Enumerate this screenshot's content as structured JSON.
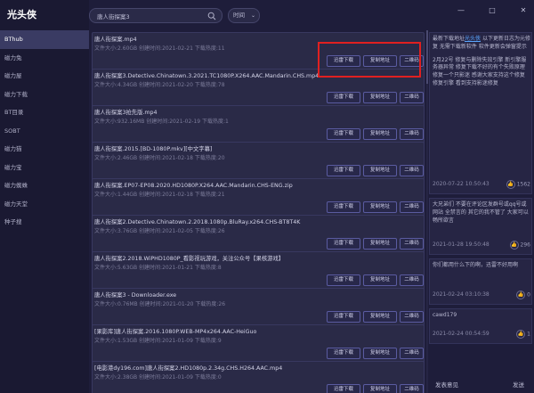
{
  "app": {
    "title": "光头侠"
  },
  "sidebar": {
    "items": [
      {
        "label": "BThub",
        "active": true
      },
      {
        "label": "磁力兔"
      },
      {
        "label": "磁力屋"
      },
      {
        "label": "磁力下载"
      },
      {
        "label": "BT目录"
      },
      {
        "label": "SOBT"
      },
      {
        "label": "磁力猫"
      },
      {
        "label": "磁力宝"
      },
      {
        "label": "磁力蜘蛛"
      },
      {
        "label": "磁力天堂"
      },
      {
        "label": "种子搜"
      }
    ]
  },
  "search": {
    "value": "唐人街探案3",
    "placeholder": ""
  },
  "sort": {
    "label": "时间",
    "icon": "chevron-down-icon"
  },
  "buttons": {
    "thunder": "迅雷下载",
    "copy": "复制地址",
    "qrcode": "二维码"
  },
  "results": [
    {
      "title": "唐人街探案.mp4",
      "meta": "文件大小:2.60GB   创建时间:2021-02-21 下载热度:11"
    },
    {
      "title": "唐人街探案3.Detective.Chinatown.3.2021.TC1080P.X264.AAC.Mandarin.CHS.mp4",
      "meta": "文件大小:4.34GB   创建时间:2021-02-20 下载热度:78"
    },
    {
      "title": "唐人街探案3抢先版.mp4",
      "meta": "文件大小:932.16MB   创建时间:2021-02-19 下载热度:1"
    },
    {
      "title": "唐人街探案.2015.[BD-1080P.mkv][中文字幕]",
      "meta": "文件大小:2.46GB   创建时间:2021-02-18 下载热度:20"
    },
    {
      "title": "唐人街探案.EP07-EP08.2020.HD1080P.X264.AAC.Mandarin.CHS-ENG.zip",
      "meta": "文件大小:1.44GB   创建时间:2021-02-18 下载热度:21"
    },
    {
      "title": "唐人街探案2.Detective.Chinatown.2.2018.1080p.BluRay.x264.CHS-BT8T4K",
      "meta": "文件大小:3.76GB   创建时间:2021-02-05 下载热度:26"
    },
    {
      "title": "唐人街探案2.2018.WiPHD1080P_看影视玩游戏，关注公众号【果核游戏】",
      "meta": "文件大小:5.63GB   创建时间:2021-01-21 下载热度:8"
    },
    {
      "title": "唐人街探案3 - Downloader.exe",
      "meta": "文件大小:0.76MB   创建时间:2021-01-20 下载热度:26"
    },
    {
      "title": "[果影库]唐人街探案.2016.1080P.WEB-MP4x264.AAC-HeiGuo",
      "meta": "文件大小:1.53GB   创建时间:2021-01-09 下载热度:9"
    },
    {
      "title": "[电影港dy196.com]唐人街探案2.HD1080p.2.34g.CHS.H264.AAC.mp4",
      "meta": "文件大小:2.38GB   创建时间:2021-01-09 下载热度:0"
    }
  ],
  "comments": [
    {
      "text_before": "最新下载地址",
      "link": "光头侠",
      "text_after": " 以下更新日志为元修复 无需下载新软件 软件更新会弹窗提示",
      "body": "2月22号 修复与删除失效引擎 新引擎服务器异常 修复下载不好的有个失败原理 修复一个只影迷 感谢大家支持这个修复 修复引擎 看到支持影迷修复",
      "date": "2020-07-22 10:50:43",
      "likes": "1562"
    },
    {
      "text": "大兄弟们 不要在评论区发群号或qq号或网站 全禁言的 其它的我不管了 大家可以畅所欲言",
      "date": "2021-01-28 19:50:48",
      "likes": "296"
    },
    {
      "text": "你们都用什么下的啊，迅雷不好用啊",
      "date": "2021-02-24 03:10:38",
      "likes": "0"
    },
    {
      "text": "cawd179",
      "date": "2021-02-24 00:54:59",
      "likes": "1"
    }
  ],
  "feedback": {
    "label": "发表意见",
    "send": "发送"
  },
  "colors": {
    "accent": "#5a5ba0",
    "highlight": "#e02020",
    "link": "#5aa6ff"
  }
}
